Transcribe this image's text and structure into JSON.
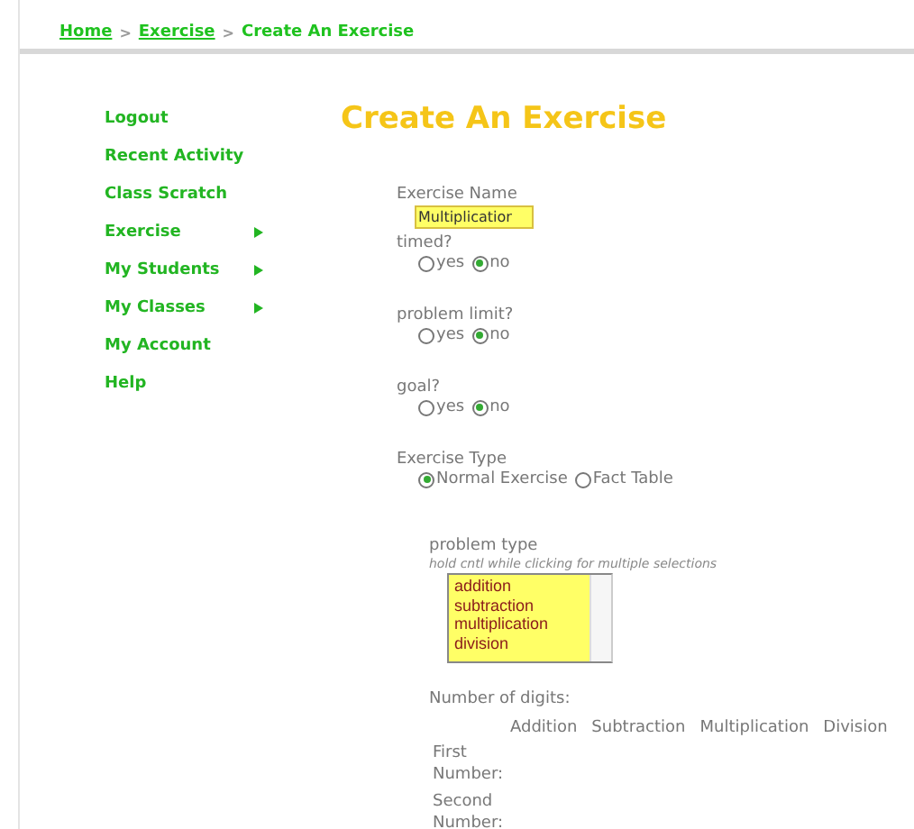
{
  "breadcrumb": [
    {
      "label": "Home",
      "kind": "link"
    },
    {
      "label": ">",
      "kind": "sep"
    },
    {
      "label": "Exercise",
      "kind": "link"
    },
    {
      "label": ">",
      "kind": "sep"
    },
    {
      "label": "Create An Exercise",
      "kind": "current"
    }
  ],
  "sidebar": {
    "items": [
      {
        "label": "Logout",
        "submenu": false
      },
      {
        "label": "Recent Activity",
        "submenu": false
      },
      {
        "label": "Class Scratch",
        "submenu": false
      },
      {
        "label": "Exercise",
        "submenu": true
      },
      {
        "label": "My Students",
        "submenu": true
      },
      {
        "label": "My Classes",
        "submenu": true
      },
      {
        "label": "My Account",
        "submenu": false
      },
      {
        "label": "Help",
        "submenu": false
      }
    ]
  },
  "title": "Create An Exercise",
  "form": {
    "name": {
      "label": "Exercise Name",
      "value": "Multiplicatior"
    },
    "radio_groups": [
      {
        "label": "timed?",
        "options": [
          {
            "label": "yes",
            "selected": false
          },
          {
            "label": "no",
            "selected": true
          }
        ]
      },
      {
        "label": "problem limit?",
        "options": [
          {
            "label": "yes",
            "selected": false
          },
          {
            "label": "no",
            "selected": true
          }
        ]
      },
      {
        "label": "goal?",
        "options": [
          {
            "label": "yes",
            "selected": false
          },
          {
            "label": "no",
            "selected": true
          }
        ]
      },
      {
        "label": "Exercise Type",
        "options": [
          {
            "label": "Normal Exercise",
            "selected": true
          },
          {
            "label": "Fact Table",
            "selected": false
          }
        ]
      }
    ],
    "problem_type": {
      "label": "problem type",
      "hint": "hold cntl while clicking for multiple selections",
      "options": [
        "addition",
        "subtraction",
        "multiplication",
        "division"
      ]
    },
    "digits": {
      "label": "Number of digits:",
      "columns": [
        "Addition",
        "Subtraction",
        "Multiplication",
        "Division"
      ],
      "rows": [
        "First Number:",
        "Second Number:"
      ]
    }
  }
}
